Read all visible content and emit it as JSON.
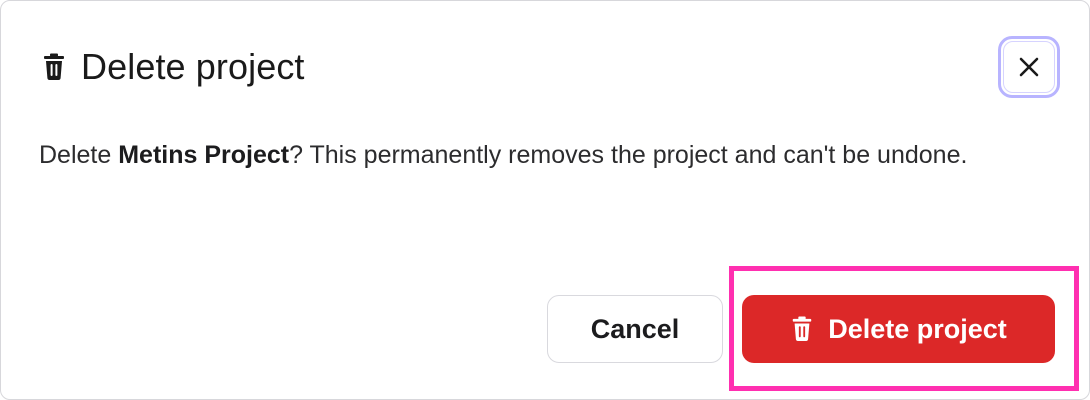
{
  "dialog": {
    "title": "Delete project",
    "title_icon": "trash-icon",
    "close_icon": "close-icon",
    "message_prefix": "Delete ",
    "project_name": "Metins Project",
    "message_suffix": "? This permanently removes the project and can't be undone."
  },
  "actions": {
    "cancel_label": "Cancel",
    "delete_label": "Delete project",
    "delete_icon": "trash-icon"
  },
  "colors": {
    "danger": "#dc2828",
    "focus_ring": "#b8b4ff",
    "highlight": "#ff2fb0"
  }
}
